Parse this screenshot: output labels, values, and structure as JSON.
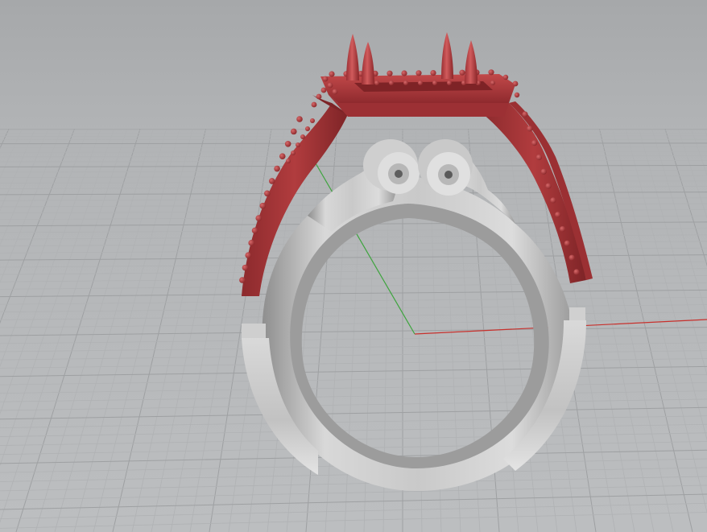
{
  "viewport": {
    "view": "perspective",
    "background_top": "#a7a9ab",
    "background_bottom": "#bdbfc1",
    "grid_minor_color": "#b0b2b4",
    "grid_major_color": "#9ea0a2",
    "axis_x_color": "#c8302c",
    "axis_y_color": "#3ea43e"
  },
  "objects": [
    {
      "name": "shank",
      "material": "silver",
      "color": "#c4c4c4"
    },
    {
      "name": "halo-head-and-shoulders",
      "material": "wax-red",
      "color": "#a8373a"
    }
  ]
}
